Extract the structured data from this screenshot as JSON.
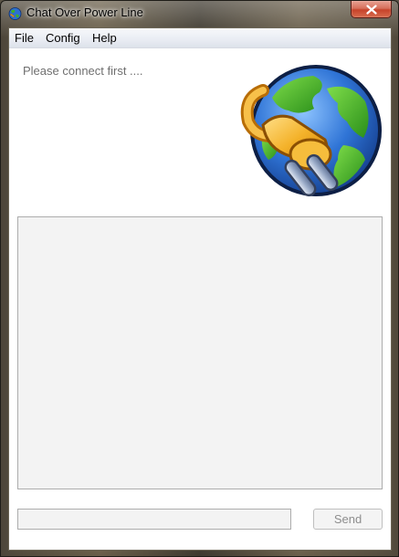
{
  "window": {
    "title": "Chat Over Power Line",
    "app_icon": "globe-plug-icon",
    "close_icon": "close-icon"
  },
  "menu": {
    "items": [
      {
        "label": "File"
      },
      {
        "label": "Config"
      },
      {
        "label": "Help"
      }
    ]
  },
  "status": {
    "text": "Please connect first ...."
  },
  "logo": {
    "icon": "globe-plug-icon"
  },
  "chat": {
    "log_text": ""
  },
  "composer": {
    "input_value": "",
    "send_label": "Send"
  },
  "colors": {
    "close_button": "#c7432a",
    "globe_ocean": "#2d6fd1",
    "globe_land": "#3fae2a",
    "plug": "#f2a51e"
  }
}
